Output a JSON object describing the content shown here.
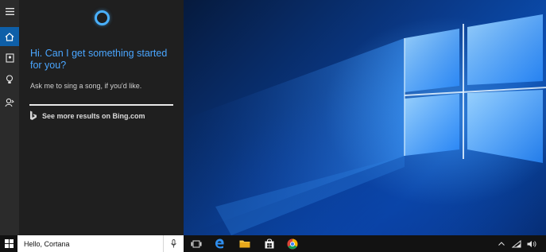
{
  "cortana": {
    "greeting": "Hi. Can I get something started for you?",
    "hint": "Ask me to sing a song, if you'd like.",
    "bing_link": "See more results on Bing.com",
    "accent": "#4aa6ff"
  },
  "rail": {
    "items": [
      "hamburger-icon",
      "home-icon",
      "notebook-icon",
      "lightbulb-icon",
      "feedback-icon"
    ],
    "active": "home-icon"
  },
  "taskbar": {
    "search_value": "Hello, Cortana",
    "apps": [
      "task-view-icon",
      "edge-icon",
      "file-explorer-icon",
      "store-icon",
      "chrome-icon"
    ],
    "tray": [
      "chevron-up-icon",
      "network-icon",
      "volume-icon"
    ]
  },
  "colors": {
    "panel": "#1f1f1f",
    "rail": "#2b2b2b",
    "active": "#0e5fa8",
    "taskbar": "#121212"
  }
}
